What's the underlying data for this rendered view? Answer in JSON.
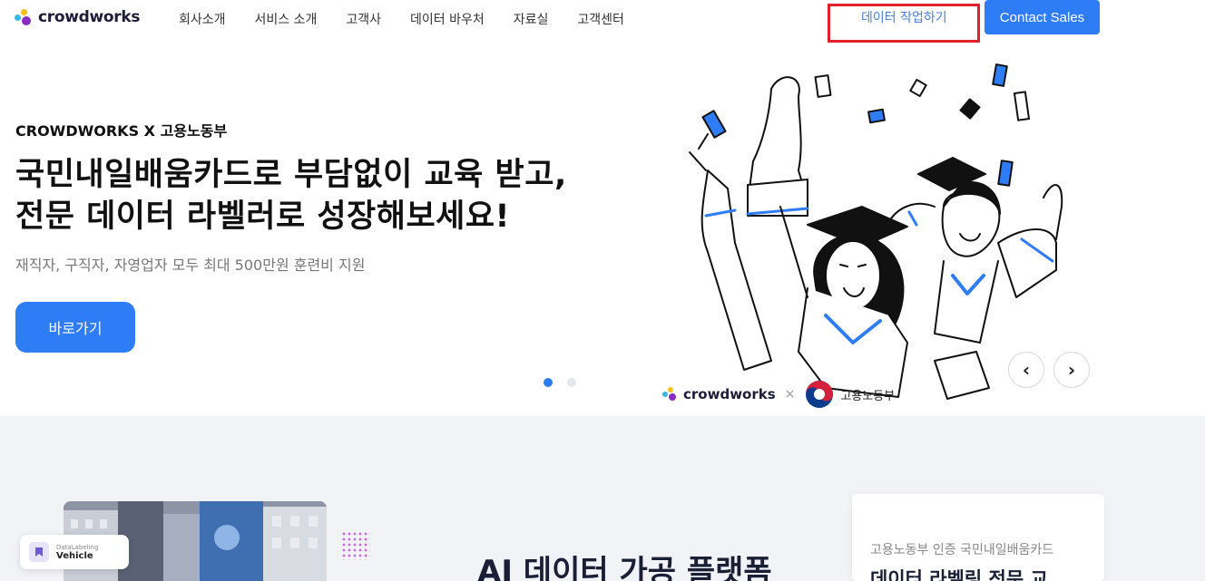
{
  "brand": {
    "name": "crowdworks"
  },
  "nav": {
    "items": [
      {
        "label": "회사소개"
      },
      {
        "label": "서비스 소개"
      },
      {
        "label": "고객사"
      },
      {
        "label": "데이터 바우처"
      },
      {
        "label": "자료실"
      },
      {
        "label": "고객센터"
      }
    ],
    "data_work_label": "데이터 작업하기",
    "contact_label": "Contact Sales"
  },
  "hero": {
    "eyebrow": "CROWDWORKS X 고용노동부",
    "headline_line1": "국민내일배움카드로 부담없이 교육 받고,",
    "headline_line2": "전문 데이터 라벨러로 성장해보세요!",
    "subline": "재직자, 구직자, 자영업자 모두 최대 500만원 훈련비 지원",
    "cta_label": "바로가기",
    "partner_brand": "crowdworks",
    "partner_separator": "×",
    "partner_ministry": "고용노동부",
    "slides": {
      "total": 2,
      "active": 1
    },
    "prev_icon": "‹",
    "next_icon": "›"
  },
  "lower": {
    "tag_small": "DataLabeling",
    "tag_big": "Vehicle",
    "title": "AI 데이터 가공 플랫폼",
    "side_small": "고용노동부 인증 국민내일배움카드",
    "side_big": "데이터 라벨링 전문 교"
  },
  "colors": {
    "accent": "#2f7df6",
    "highlight_box": "#e0202a",
    "section_bg": "#f2f3f6"
  }
}
